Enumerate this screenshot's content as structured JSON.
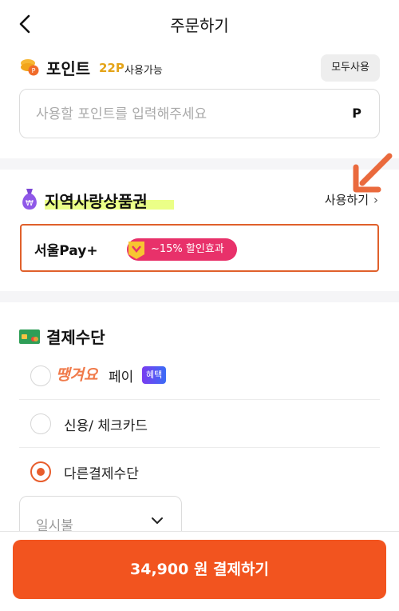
{
  "header": {
    "title": "주문하기"
  },
  "points": {
    "title": "포인트",
    "amount": "22P",
    "available_label": "사용가능",
    "use_all_label": "모두사용",
    "input_placeholder": "사용할 포인트를 입력해주세요",
    "unit": "P"
  },
  "voucher": {
    "title": "지역사랑상품권",
    "use_link": "사용하기",
    "selected_name": "서울Pay+",
    "discount": "~15% 할인효과"
  },
  "payment": {
    "title": "결제수단",
    "options": [
      {
        "logo_text": "땡겨요",
        "label": "페이",
        "badge": "혜택",
        "selected": false
      },
      {
        "label": "신용/ 체크카드",
        "selected": false
      },
      {
        "label": "다른결제수단",
        "selected": true
      }
    ],
    "installment": {
      "value": "일시불"
    }
  },
  "checkout": {
    "button_label": "34,900 원 결제하기"
  },
  "colors": {
    "accent": "#f2541f",
    "voucher_border": "#e0602b",
    "discount_pill": "#e8316a",
    "points_yellow": "#e4a419"
  },
  "icons": [
    "back-arrow-icon",
    "coin-icon",
    "money-bag-icon",
    "card-icon",
    "chevron-right-icon",
    "chevron-down-icon",
    "annotation-arrow-icon"
  ]
}
